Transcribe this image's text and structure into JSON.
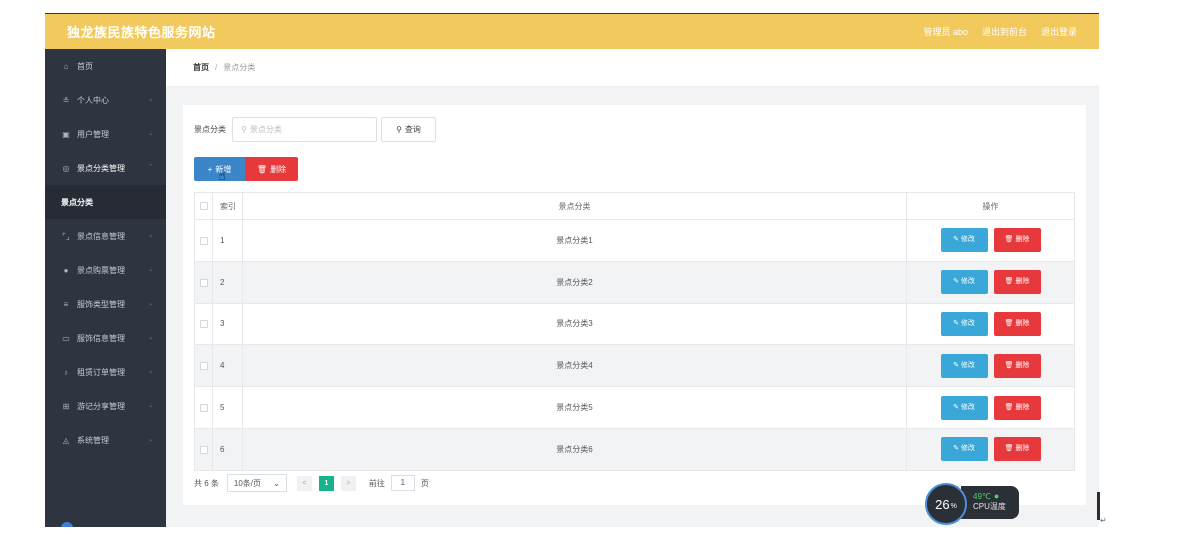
{
  "header": {
    "title": "独龙族民族特色服务网站",
    "admin": "管理员 abo",
    "back_label": "退出到前台",
    "logout_label": "退出登录",
    "bg_color": "#f1c95c"
  },
  "sidebar": {
    "bg_color": "#2f3441",
    "items": [
      {
        "icon": "home-icon",
        "glyph": "⌂",
        "label": "首页"
      },
      {
        "icon": "user-icon",
        "glyph": "≗",
        "label": "个人中心"
      },
      {
        "icon": "users-icon",
        "glyph": "▣",
        "label": "用户管理"
      },
      {
        "icon": "circle-icon",
        "glyph": "◎",
        "label": "景点分类管理"
      },
      {
        "label": "景点分类"
      },
      {
        "icon": "frame-icon",
        "glyph": "⌜⌟",
        "label": "景点信息管理"
      },
      {
        "icon": "location-icon",
        "glyph": "●",
        "label": "景点购票管理"
      },
      {
        "icon": "list-icon",
        "glyph": "≡",
        "label": "服饰类型管理"
      },
      {
        "icon": "message-icon",
        "glyph": "▭",
        "label": "服饰信息管理"
      },
      {
        "icon": "microphone-icon",
        "glyph": "♁",
        "label": "租赁订单管理"
      },
      {
        "icon": "grid-icon",
        "glyph": "⊞",
        "label": "游记分享管理"
      },
      {
        "icon": "settings-icon",
        "glyph": "◬",
        "label": "系统管理"
      }
    ]
  },
  "breadcrumb": {
    "home": "首页",
    "separator": "/",
    "current": "景点分类"
  },
  "search": {
    "label": "景点分类",
    "placeholder": "景点分类",
    "query_label": "查询"
  },
  "actions": {
    "add_label": "新增",
    "delete_label": "删除"
  },
  "table": {
    "headers": {
      "index": "索引",
      "category": "景点分类",
      "ops": "操作"
    },
    "rows": [
      {
        "index": "1",
        "category": "景点分类1"
      },
      {
        "index": "2",
        "category": "景点分类2"
      },
      {
        "index": "3",
        "category": "景点分类3"
      },
      {
        "index": "4",
        "category": "景点分类4"
      },
      {
        "index": "5",
        "category": "景点分类5"
      },
      {
        "index": "6",
        "category": "景点分类6"
      }
    ],
    "edit_label": "修改",
    "delete_label": "删除"
  },
  "pager": {
    "total": "共 6 条",
    "page_size": "10条/页",
    "prev": "<",
    "current": "1",
    "next": ">",
    "goto_prefix": "前往",
    "goto_value": "1",
    "goto_suffix": "页"
  },
  "cpu_widget": {
    "percent": "26",
    "percent_unit": "%",
    "temperature": "49℃",
    "label": "CPU温度"
  },
  "colors": {
    "add_button": "#3a86c8",
    "delete_button": "#e7393c",
    "edit_button": "#3aa7d9",
    "pager_active": "#17b38a"
  }
}
